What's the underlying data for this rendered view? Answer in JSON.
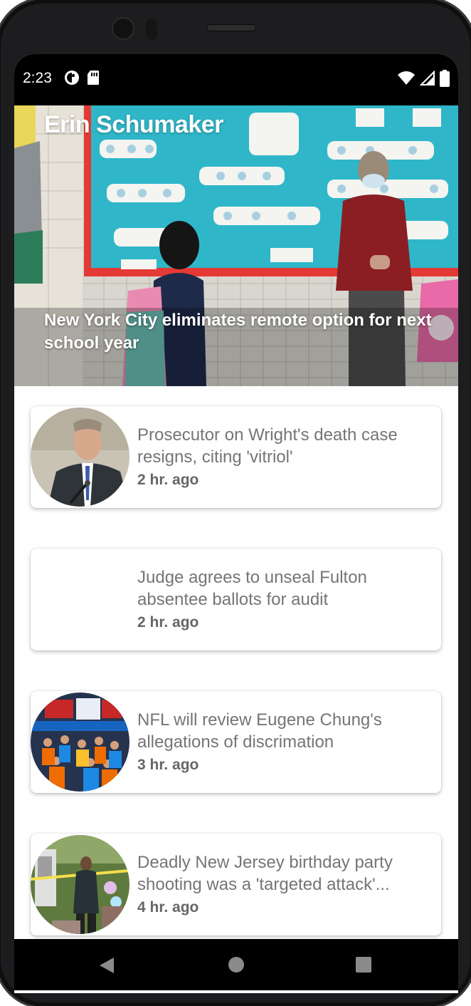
{
  "status_bar": {
    "time": "2:23",
    "left_icons": [
      "app-notification-icon",
      "sd-card-icon"
    ],
    "right_icons": [
      "wifi-icon",
      "cell-signal-icon",
      "battery-icon"
    ]
  },
  "hero": {
    "author": "Erin Schumaker",
    "headline": "New York City eliminates remote option for next school year"
  },
  "articles": [
    {
      "title": "Prosecutor on Wright's death case resigns, citing 'vitriol'",
      "time": "2 hr. ago",
      "has_image": true
    },
    {
      "title": "Judge agrees to unseal Fulton absentee ballots for audit",
      "time": "2 hr. ago",
      "has_image": false
    },
    {
      "title": "NFL will review Eugene Chung's allegations of discrimation",
      "time": "3 hr. ago",
      "has_image": true
    },
    {
      "title": "Deadly New Jersey birthday party shooting was a 'targeted attack'...",
      "time": "4 hr. ago",
      "has_image": true
    }
  ],
  "nav_bar": {
    "buttons": [
      "back-icon",
      "home-icon",
      "recents-icon"
    ]
  },
  "colors": {
    "status_bar": "#000000",
    "card_title": "#757575",
    "card_time": "#666666",
    "bulletin_board": "#2fb7c9",
    "bulletin_border": "#e53935"
  }
}
